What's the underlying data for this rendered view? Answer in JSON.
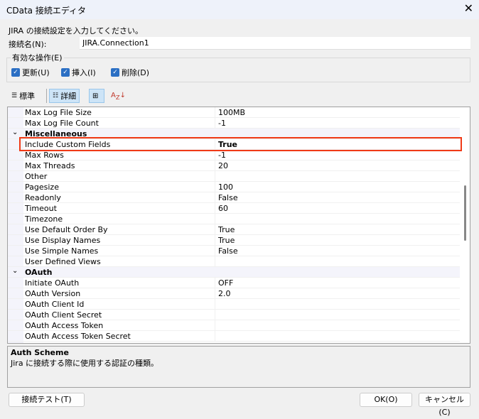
{
  "window": {
    "title": "CData 接続エディタ"
  },
  "intro": "JIRA の接続設定を入力してください。",
  "connection": {
    "label": "接続名(N):",
    "value": "JIRA.Connection1"
  },
  "operations": {
    "legend": "有効な操作(E)",
    "items": [
      {
        "label": "更新(U)",
        "checked": true
      },
      {
        "label": "挿入(I)",
        "checked": true
      },
      {
        "label": "削除(D)",
        "checked": true
      }
    ]
  },
  "toolbar": {
    "standard": "標準",
    "detailed": "詳細"
  },
  "grid": {
    "rows": [
      {
        "name": "Max Log File Size",
        "value": "100MB"
      },
      {
        "name": "Max Log File Count",
        "value": "-1"
      },
      {
        "name": "Miscellaneous",
        "category": true
      },
      {
        "name": "Include Custom Fields",
        "value": "True",
        "bold": true
      },
      {
        "name": "Max Rows",
        "value": "-1"
      },
      {
        "name": "Max Threads",
        "value": "20"
      },
      {
        "name": "Other",
        "value": ""
      },
      {
        "name": "Pagesize",
        "value": "100"
      },
      {
        "name": "Readonly",
        "value": "False"
      },
      {
        "name": "Timeout",
        "value": "60"
      },
      {
        "name": "Timezone",
        "value": ""
      },
      {
        "name": "Use Default Order By",
        "value": "True"
      },
      {
        "name": "Use Display Names",
        "value": "True"
      },
      {
        "name": "Use Simple Names",
        "value": "False"
      },
      {
        "name": "User Defined Views",
        "value": ""
      },
      {
        "name": "OAuth",
        "category": true
      },
      {
        "name": "Initiate OAuth",
        "value": "OFF"
      },
      {
        "name": "OAuth Version",
        "value": "2.0"
      },
      {
        "name": "OAuth Client Id",
        "value": ""
      },
      {
        "name": "OAuth Client Secret",
        "value": ""
      },
      {
        "name": "OAuth Access Token",
        "value": ""
      },
      {
        "name": "OAuth Access Token Secret",
        "value": ""
      }
    ]
  },
  "description": {
    "title": "Auth Scheme",
    "text": "Jira に接続する際に使用する認証の種類。"
  },
  "buttons": {
    "test": "接続テスト(T)",
    "ok": "OK(O)",
    "cancel": "キャンセル(C)"
  }
}
